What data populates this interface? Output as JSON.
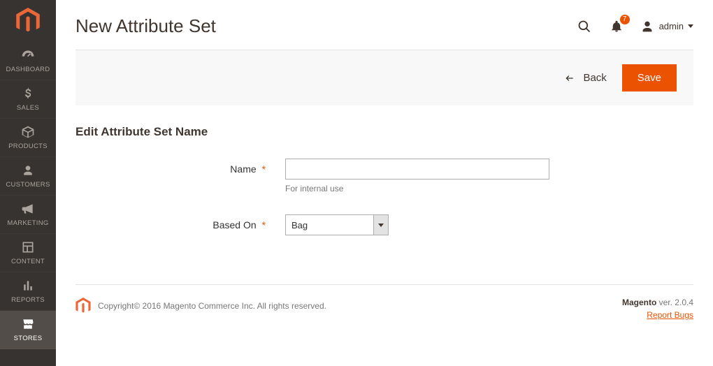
{
  "sidebar": {
    "items": [
      {
        "label": "DASHBOARD"
      },
      {
        "label": "SALES"
      },
      {
        "label": "PRODUCTS"
      },
      {
        "label": "CUSTOMERS"
      },
      {
        "label": "MARKETING"
      },
      {
        "label": "CONTENT"
      },
      {
        "label": "REPORTS"
      },
      {
        "label": "STORES"
      }
    ]
  },
  "header": {
    "title": "New Attribute Set",
    "notification_count": "7",
    "admin_label": "admin"
  },
  "actions": {
    "back_label": "Back",
    "save_label": "Save"
  },
  "form": {
    "section_title": "Edit Attribute Set Name",
    "name_label": "Name",
    "name_value": "",
    "name_hint": "For internal use",
    "basedon_label": "Based On",
    "basedon_value": "Bag"
  },
  "footer": {
    "copyright": "Copyright© 2016 Magento Commerce Inc. All rights reserved.",
    "product": "Magento",
    "version": " ver. 2.0.4",
    "report_link": "Report Bugs"
  }
}
